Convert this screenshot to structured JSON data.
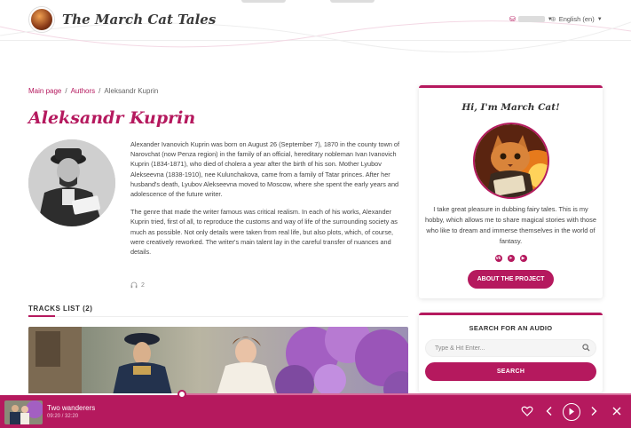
{
  "header": {
    "site_title": "The March Cat Tales",
    "language": "English (en)"
  },
  "breadcrumb": {
    "home": "Main page",
    "section": "Authors",
    "current": "Aleksandr Kuprin"
  },
  "page": {
    "title": "Aleksandr Kuprin",
    "bio_paragraphs": [
      "Alexander Ivanovich Kuprin was born on August 26 (September 7), 1870 in the county town of Narovchat (now Penza region) in the family of an official, hereditary nobleman Ivan Ivanovich Kuprin (1834-1871), who died of cholera a year after the birth of his son. Mother Lyubov Alekseevna (1838-1910), nee Kulunchakova, came from a family of Tatar princes. After her husband's death, Lyubov Alekseevna moved to Moscow, where she spent the early years and adolescence of the future writer.",
      "The genre that made the writer famous was critical realism. In each of his works, Alexander Kuprin tried, first of all, to reproduce the customs and way of life of the surrounding society as much as possible. Not only details were taken from real life, but also plots, which, of course, were creatively reworked. The writer's main talent lay in the careful transfer of nuances and details."
    ],
    "views_count": "2",
    "tracks_heading": "TRACKS LIST (2)"
  },
  "sidebar": {
    "about_title": "Hi, I'm March Cat!",
    "about_text": "I take great pleasure in dubbing fairy tales. This is my hobby, which allows me to share magical stories with those who like to dream and immerse themselves in the world of fantasy.",
    "socials": [
      {
        "icon": "vk-icon",
        "glyph": "vk"
      },
      {
        "icon": "telegram-icon",
        "glyph": "➤"
      },
      {
        "icon": "youtube-icon",
        "glyph": "▶"
      }
    ],
    "about_button": "ABOUT THE PROJECT",
    "search_title": "SEARCH FOR AN AUDIO",
    "search_placeholder": "Type & Hit Enter...",
    "search_button": "SEARCH"
  },
  "player": {
    "track_title": "Two wanderers",
    "time": "09:20 / 32:20",
    "progress_fraction": 0.2886
  },
  "colors": {
    "accent": "#b5195e"
  }
}
